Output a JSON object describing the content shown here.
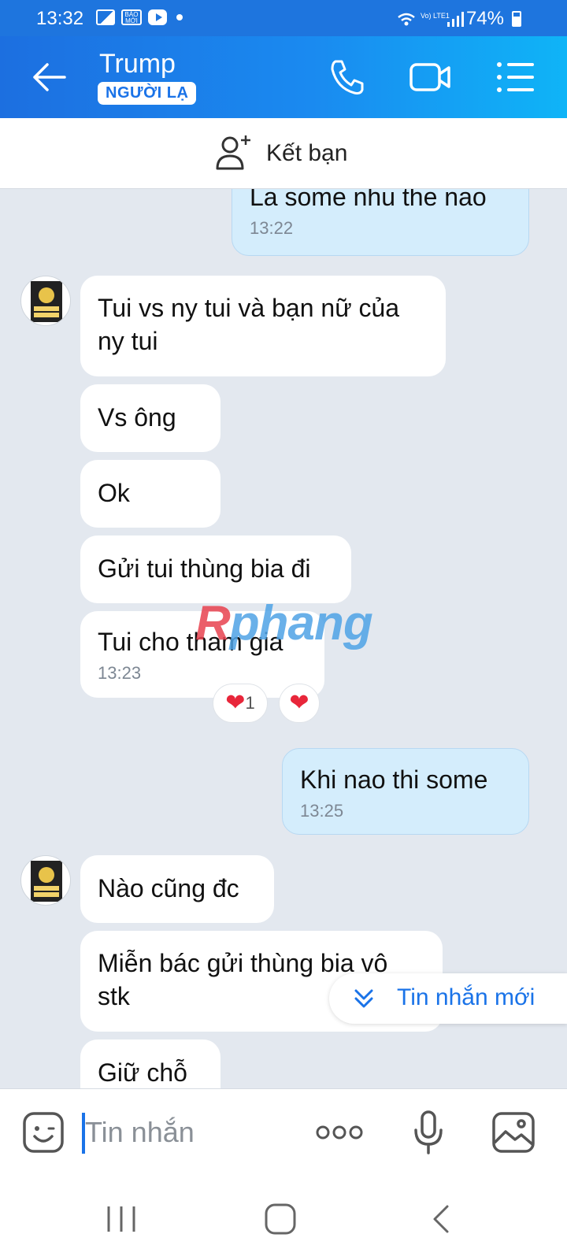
{
  "status_bar": {
    "time": "13:32",
    "news_icon_text": "BÁO MỚI",
    "network_label": "Vo) LTE1",
    "battery": "74%"
  },
  "header": {
    "contact_name": "Trump",
    "badge": "NGƯỜI LẠ"
  },
  "add_friend": {
    "label": "Kết bạn"
  },
  "messages": [
    {
      "sender": "me",
      "text": "La some nhu the nao",
      "time": "13:22"
    },
    {
      "sender": "them",
      "text": "Tui vs ny tui và bạn nữ của ny tui",
      "time": ""
    },
    {
      "sender": "them",
      "text": "Vs ông",
      "time": ""
    },
    {
      "sender": "them",
      "text": "Ok",
      "time": ""
    },
    {
      "sender": "them",
      "text": "Gửi tui thùng bia đi",
      "time": ""
    },
    {
      "sender": "them",
      "text": "Tui cho tham gia",
      "time": "13:23",
      "reaction_count": "1"
    },
    {
      "sender": "me",
      "text": "Khi nao thi some",
      "time": "13:25"
    },
    {
      "sender": "them",
      "text": "Nào cũng đc",
      "time": ""
    },
    {
      "sender": "them",
      "text": "Miễn bác gửi thùng bia vô stk",
      "time": ""
    },
    {
      "sender": "them",
      "text": "Giữ chỗ",
      "time": ""
    }
  ],
  "watermark": {
    "prefix": "R",
    "rest": "phang"
  },
  "new_messages_label": "Tin nhắn mới",
  "input": {
    "placeholder": "Tin nhắn",
    "value": ""
  },
  "colors": {
    "header_start": "#1c6fe0",
    "header_end": "#0fb4f7",
    "my_bubble": "#d4edfc",
    "chat_bg": "#e3e8ef",
    "accent": "#1a73e8",
    "heart": "#e8263a"
  },
  "icons": [
    "back-arrow-icon",
    "phone-icon",
    "video-call-icon",
    "list-menu-icon",
    "add-friend-icon",
    "chevron-double-down-icon",
    "emoji-sticker-icon",
    "more-dots-icon",
    "microphone-icon",
    "image-icon",
    "recents-icon",
    "home-icon",
    "back-nav-icon",
    "heart-icon"
  ]
}
